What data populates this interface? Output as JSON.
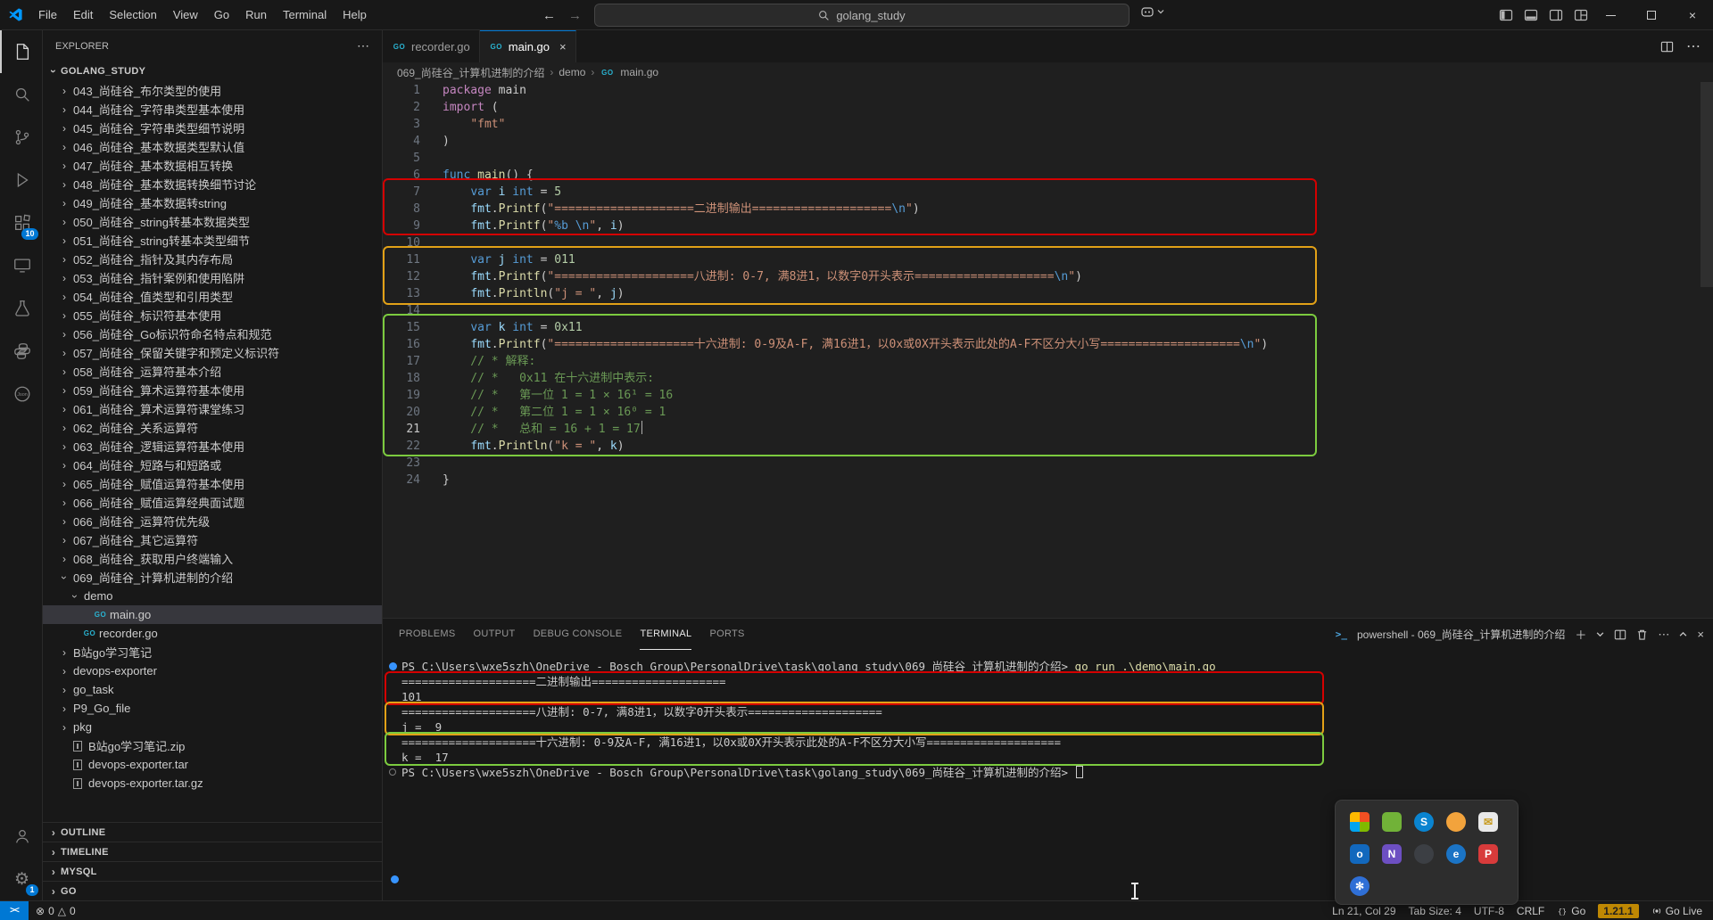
{
  "window": {
    "search": "golang_study"
  },
  "menu": {
    "items": [
      "File",
      "Edit",
      "Selection",
      "View",
      "Go",
      "Run",
      "Terminal",
      "Help"
    ]
  },
  "activity": {
    "extensions_badge": "10",
    "settings_badge": "1"
  },
  "explorer": {
    "title": "EXPLORER",
    "root": "GOLANG_STUDY",
    "tree": [
      {
        "label": "043_尚硅谷_布尔类型的使用",
        "level": 1,
        "kind": "folder"
      },
      {
        "label": "044_尚硅谷_字符串类型基本使用",
        "level": 1,
        "kind": "folder"
      },
      {
        "label": "045_尚硅谷_字符串类型细节说明",
        "level": 1,
        "kind": "folder"
      },
      {
        "label": "046_尚硅谷_基本数据类型默认值",
        "level": 1,
        "kind": "folder"
      },
      {
        "label": "047_尚硅谷_基本数据相互转换",
        "level": 1,
        "kind": "folder"
      },
      {
        "label": "048_尚硅谷_基本数据转换细节讨论",
        "level": 1,
        "kind": "folder"
      },
      {
        "label": "049_尚硅谷_基本数据转string",
        "level": 1,
        "kind": "folder"
      },
      {
        "label": "050_尚硅谷_string转基本数据类型",
        "level": 1,
        "kind": "folder"
      },
      {
        "label": "051_尚硅谷_string转基本类型细节",
        "level": 1,
        "kind": "folder"
      },
      {
        "label": "052_尚硅谷_指针及其内存布局",
        "level": 1,
        "kind": "folder"
      },
      {
        "label": "053_尚硅谷_指针案例和使用陷阱",
        "level": 1,
        "kind": "folder"
      },
      {
        "label": "054_尚硅谷_值类型和引用类型",
        "level": 1,
        "kind": "folder"
      },
      {
        "label": "055_尚硅谷_标识符基本使用",
        "level": 1,
        "kind": "folder"
      },
      {
        "label": "056_尚硅谷_Go标识符命名特点和规范",
        "level": 1,
        "kind": "folder"
      },
      {
        "label": "057_尚硅谷_保留关键字和预定义标识符",
        "level": 1,
        "kind": "folder"
      },
      {
        "label": "058_尚硅谷_运算符基本介绍",
        "level": 1,
        "kind": "folder"
      },
      {
        "label": "059_尚硅谷_算术运算符基本使用",
        "level": 1,
        "kind": "folder"
      },
      {
        "label": "061_尚硅谷_算术运算符课堂练习",
        "level": 1,
        "kind": "folder"
      },
      {
        "label": "062_尚硅谷_关系运算符",
        "level": 1,
        "kind": "folder"
      },
      {
        "label": "063_尚硅谷_逻辑运算符基本使用",
        "level": 1,
        "kind": "folder"
      },
      {
        "label": "064_尚硅谷_短路与和短路或",
        "level": 1,
        "kind": "folder"
      },
      {
        "label": "065_尚硅谷_赋值运算符基本使用",
        "level": 1,
        "kind": "folder"
      },
      {
        "label": "066_尚硅谷_赋值运算经典面试题",
        "level": 1,
        "kind": "folder"
      },
      {
        "label": "066_尚硅谷_运算符优先级",
        "level": 1,
        "kind": "folder"
      },
      {
        "label": "067_尚硅谷_其它运算符",
        "level": 1,
        "kind": "folder"
      },
      {
        "label": "068_尚硅谷_获取用户终端输入",
        "level": 1,
        "kind": "folder"
      },
      {
        "label": "069_尚硅谷_计算机进制的介绍",
        "level": 1,
        "kind": "folder-open"
      },
      {
        "label": "demo",
        "level": 2,
        "kind": "folder-open"
      },
      {
        "label": "main.go",
        "level": 3,
        "kind": "go",
        "selected": true
      },
      {
        "label": "recorder.go",
        "level": 2,
        "kind": "go"
      },
      {
        "label": "B站go学习笔记",
        "level": 1,
        "kind": "folder"
      },
      {
        "label": "devops-exporter",
        "level": 1,
        "kind": "folder"
      },
      {
        "label": "go_task",
        "level": 1,
        "kind": "folder"
      },
      {
        "label": "P9_Go_file",
        "level": 1,
        "kind": "folder"
      },
      {
        "label": "pkg",
        "level": 1,
        "kind": "folder"
      },
      {
        "label": "B站go学习笔记.zip",
        "level": 1,
        "kind": "archive"
      },
      {
        "label": "devops-exporter.tar",
        "level": 1,
        "kind": "archive"
      },
      {
        "label": "devops-exporter.tar.gz",
        "level": 1,
        "kind": "archive"
      }
    ],
    "sections": [
      "OUTLINE",
      "TIMELINE",
      "MYSQL",
      "GO"
    ]
  },
  "editor": {
    "tabs": [
      {
        "label": "recorder.go"
      },
      {
        "label": "main.go"
      }
    ],
    "breadcrumb": [
      "069_尚硅谷_计算机进制的介绍",
      "demo",
      "main.go"
    ],
    "active_line": 21,
    "lines": [
      [
        [
          "kw",
          "package"
        ],
        [
          "d",
          " main"
        ]
      ],
      [
        [
          "kw",
          "import"
        ],
        [
          "d",
          " ("
        ]
      ],
      [
        [
          "d",
          "    "
        ],
        [
          "str",
          "\"fmt\""
        ]
      ],
      [
        [
          "d",
          ")"
        ]
      ],
      [],
      [
        [
          "kw2",
          "func"
        ],
        [
          "d",
          " "
        ],
        [
          "fn",
          "main"
        ],
        [
          "d",
          "() {"
        ]
      ],
      [
        [
          "d",
          "    "
        ],
        [
          "kw2",
          "var"
        ],
        [
          "d",
          " "
        ],
        [
          "var",
          "i"
        ],
        [
          "d",
          " "
        ],
        [
          "type",
          "int"
        ],
        [
          "d",
          " = "
        ],
        [
          "num",
          "5"
        ]
      ],
      [
        [
          "d",
          "    "
        ],
        [
          "var",
          "fmt"
        ],
        [
          "d",
          "."
        ],
        [
          "fn",
          "Printf"
        ],
        [
          "d",
          "("
        ],
        [
          "str",
          "\"====================二进制输出===================="
        ],
        [
          "esc",
          "\\n"
        ],
        [
          "str",
          "\""
        ],
        [
          "d",
          ")"
        ]
      ],
      [
        [
          "d",
          "    "
        ],
        [
          "var",
          "fmt"
        ],
        [
          "d",
          "."
        ],
        [
          "fn",
          "Printf"
        ],
        [
          "d",
          "("
        ],
        [
          "str",
          "\""
        ],
        [
          "esc",
          "%b"
        ],
        [
          "str",
          " "
        ],
        [
          "esc",
          "\\n"
        ],
        [
          "str",
          "\""
        ],
        [
          "d",
          ", "
        ],
        [
          "var",
          "i"
        ],
        [
          "d",
          ")"
        ]
      ],
      [],
      [
        [
          "d",
          "    "
        ],
        [
          "kw2",
          "var"
        ],
        [
          "d",
          " "
        ],
        [
          "var",
          "j"
        ],
        [
          "d",
          " "
        ],
        [
          "type",
          "int"
        ],
        [
          "d",
          " = "
        ],
        [
          "num",
          "011"
        ]
      ],
      [
        [
          "d",
          "    "
        ],
        [
          "var",
          "fmt"
        ],
        [
          "d",
          "."
        ],
        [
          "fn",
          "Printf"
        ],
        [
          "d",
          "("
        ],
        [
          "str",
          "\"====================八进制: 0-7, 满8进1，以数字0开头表示===================="
        ],
        [
          "esc",
          "\\n"
        ],
        [
          "str",
          "\""
        ],
        [
          "d",
          ")"
        ]
      ],
      [
        [
          "d",
          "    "
        ],
        [
          "var",
          "fmt"
        ],
        [
          "d",
          "."
        ],
        [
          "fn",
          "Println"
        ],
        [
          "d",
          "("
        ],
        [
          "str",
          "\"j = \""
        ],
        [
          "d",
          ", "
        ],
        [
          "var",
          "j"
        ],
        [
          "d",
          ")"
        ]
      ],
      [],
      [
        [
          "d",
          "    "
        ],
        [
          "kw2",
          "var"
        ],
        [
          "d",
          " "
        ],
        [
          "var",
          "k"
        ],
        [
          "d",
          " "
        ],
        [
          "type",
          "int"
        ],
        [
          "d",
          " = "
        ],
        [
          "num",
          "0x11"
        ]
      ],
      [
        [
          "d",
          "    "
        ],
        [
          "var",
          "fmt"
        ],
        [
          "d",
          "."
        ],
        [
          "fn",
          "Printf"
        ],
        [
          "d",
          "("
        ],
        [
          "str",
          "\"====================十六进制: 0-9及A-F, 满16进1，以0x或0X开头表示此处的A-F不区分大小写===================="
        ],
        [
          "esc",
          "\\n"
        ],
        [
          "str",
          "\""
        ],
        [
          "d",
          ")"
        ]
      ],
      [
        [
          "cmt",
          "    // * 解释:"
        ]
      ],
      [
        [
          "cmt",
          "    // *   0x11 在十六进制中表示:"
        ]
      ],
      [
        [
          "cmt",
          "    // *   第一位 1 = 1 × 16¹ = 16"
        ]
      ],
      [
        [
          "cmt",
          "    // *   第二位 1 = 1 × 16⁰ = 1"
        ]
      ],
      [
        [
          "cmt",
          "    // *   总和 = 16 + 1 = 17"
        ]
      ],
      [
        [
          "d",
          "    "
        ],
        [
          "var",
          "fmt"
        ],
        [
          "d",
          "."
        ],
        [
          "fn",
          "Println"
        ],
        [
          "d",
          "("
        ],
        [
          "str",
          "\"k = \""
        ],
        [
          "d",
          ", "
        ],
        [
          "var",
          "k"
        ],
        [
          "d",
          ")"
        ]
      ],
      [],
      [
        [
          "d",
          "}"
        ]
      ]
    ]
  },
  "terminal": {
    "tabs": [
      "PROBLEMS",
      "OUTPUT",
      "DEBUG CONSOLE",
      "TERMINAL",
      "PORTS"
    ],
    "active": "TERMINAL",
    "shell": "powershell - 069_尚硅谷_计算机进制的介绍",
    "lines": [
      {
        "deco": "filled",
        "tokens": [
          [
            "d",
            "PS C:\\Users\\wxe5szh\\OneDrive - Bosch Group\\PersonalDrive\\task\\golang_study\\069_尚硅谷_计算机进制的介绍> "
          ],
          [
            "cmd",
            "go run .\\demo\\main.go"
          ]
        ]
      },
      {
        "tokens": [
          [
            "d",
            "====================二进制输出===================="
          ]
        ]
      },
      {
        "tokens": [
          [
            "d",
            "101"
          ]
        ]
      },
      {
        "tokens": [
          [
            "d",
            "====================八进制: 0-7, 满8进1，以数字0开头表示===================="
          ]
        ]
      },
      {
        "tokens": [
          [
            "d",
            "j =  9"
          ]
        ]
      },
      {
        "tokens": [
          [
            "d",
            "====================十六进制: 0-9及A-F, 满16进1，以0x或0X开头表示此处的A-F不区分大小写===================="
          ]
        ]
      },
      {
        "tokens": [
          [
            "d",
            "k =  17"
          ]
        ]
      },
      {
        "deco": "outline",
        "cursor": true,
        "tokens": [
          [
            "d",
            "PS C:\\Users\\wxe5szh\\OneDrive - Bosch Group\\PersonalDrive\\task\\golang_study\\069_尚硅谷_计算机进制的介绍> "
          ]
        ]
      }
    ]
  },
  "status": {
    "remote": "><",
    "errors": "0",
    "warnings": "0",
    "line_col": "Ln 21, Col 29",
    "tab_size": "Tab Size: 4",
    "encoding": "UTF-8",
    "eol": "CRLF",
    "lang": "Go",
    "go_version": "1.21.1",
    "live": "Go Live"
  },
  "icons": {
    "go_badge": "GO",
    "error_glyph": "⊗",
    "warning_glyph": "△",
    "shell_glyph": ">_"
  },
  "tray": {
    "icons": [
      {
        "kind": "ms"
      },
      {
        "bg": "#71b238",
        "shape": "square",
        "letter": ""
      },
      {
        "bg": "#0a84d0",
        "shape": "circle",
        "letter": "S"
      },
      {
        "bg": "#f2a33c",
        "shape": "circle",
        "letter": ""
      },
      {
        "bg": "#e9e9e9",
        "shape": "square",
        "letter": "✉",
        "fg": "#c79a1e"
      },
      {
        "bg": "#1268bd",
        "shape": "square",
        "letter": "o"
      },
      {
        "bg": "#6d4fc2",
        "shape": "square",
        "letter": "N"
      },
      {
        "bg": "#3c3f44",
        "shape": "circle",
        "letter": ""
      },
      {
        "bg": "#1b74c5",
        "shape": "circle",
        "letter": "e"
      },
      {
        "bg": "#d83b3b",
        "shape": "square",
        "letter": "P"
      },
      {
        "bg": "#2f6fd6",
        "shape": "circle",
        "letter": "✻"
      }
    ]
  }
}
